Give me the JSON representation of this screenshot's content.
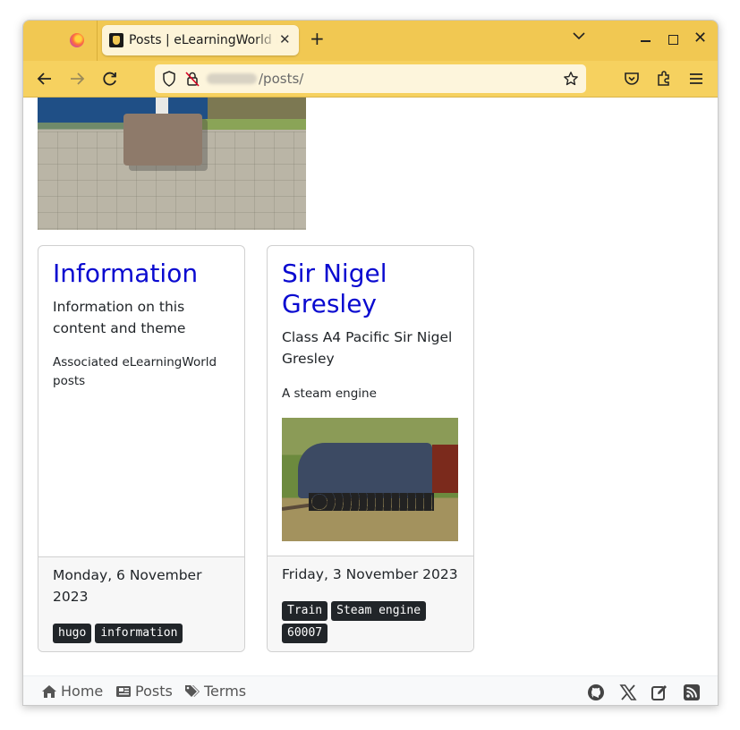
{
  "browser": {
    "tab_title": "Posts | eLearningWorld E",
    "tab_close": "✕",
    "new_tab": "+",
    "url_path": "/posts/"
  },
  "page": {
    "cards": [
      {
        "title": "Information",
        "description": "Information on this content and theme",
        "subtitle": "Associated eLearningWorld posts",
        "date": "Monday, 6 November 2023",
        "tags": [
          "hugo",
          "information"
        ]
      },
      {
        "title": "Sir Nigel Gresley",
        "description": "Class A4 Pacific Sir Nigel Gresley",
        "subtitle": "A steam engine",
        "date": "Friday, 3 November 2023",
        "tags": [
          "Train",
          "Steam engine",
          "60007"
        ]
      }
    ]
  },
  "footer": {
    "home": "Home",
    "posts": "Posts",
    "terms": "Terms",
    "icons": [
      "github-icon",
      "x-icon",
      "edit-icon",
      "rss-icon"
    ]
  },
  "colors": {
    "tabstrip": "#f1c852",
    "navbar": "#f6d15f",
    "link": "#0a0ad0",
    "tag_bg": "#212529"
  }
}
